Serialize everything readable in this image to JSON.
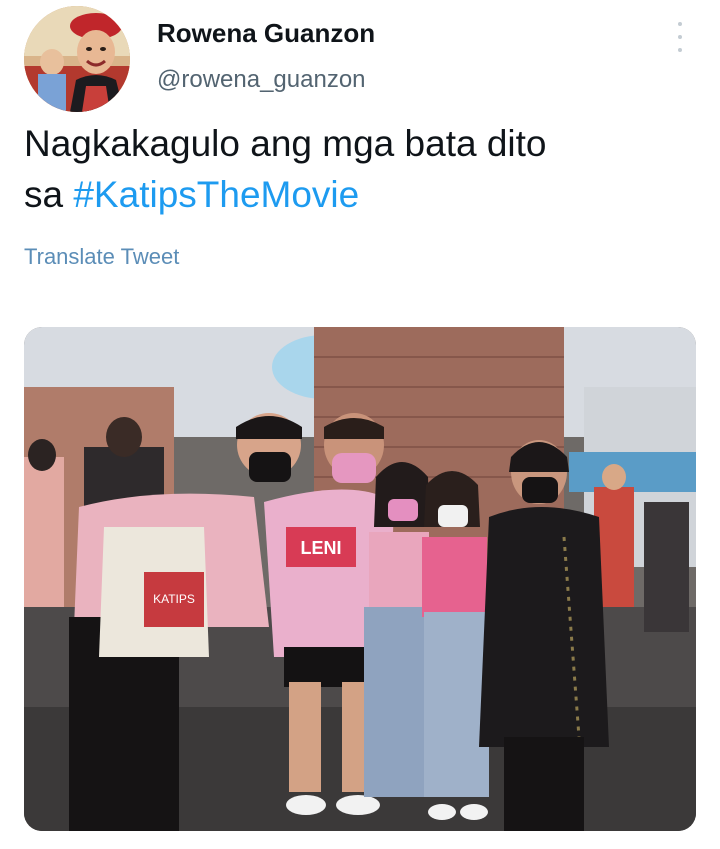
{
  "tweet": {
    "author": {
      "display_name": "Rowena Guanzon",
      "handle": "@rowena_guanzon"
    },
    "text_line1": "Nagkakagulo ang mga bata dito",
    "text_line2_prefix": "sa ",
    "hashtag": "#KatipsTheMovie",
    "translate_label": "Translate Tweet",
    "photo_shirt_text": "LENI",
    "photo_tote_text": "KATIPS"
  },
  "icons": {
    "more": "more-vertical-icon"
  },
  "colors": {
    "link": "#1d9bf0",
    "translate": "#5b8db7",
    "handle": "#536471",
    "text": "#0f1419"
  }
}
